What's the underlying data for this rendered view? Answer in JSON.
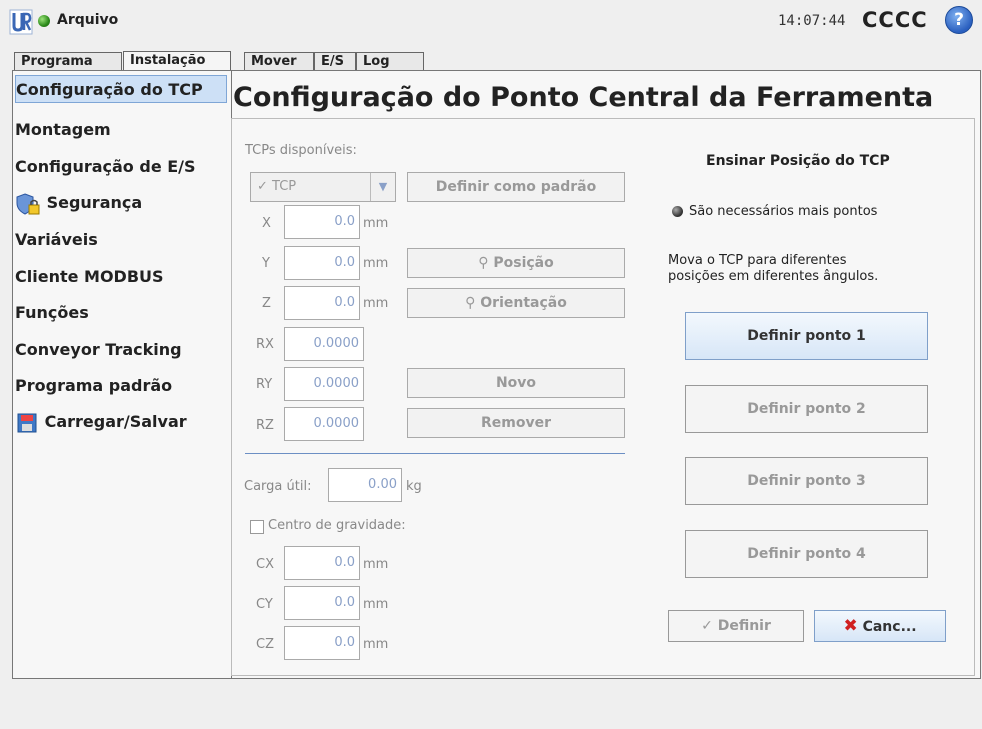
{
  "header": {
    "app_title": "Arquivo",
    "clock": "14:07:44",
    "robot_name": "CCCC",
    "help_label": "?"
  },
  "tabs": [
    {
      "label": "Programa"
    },
    {
      "label": "Instalação"
    },
    {
      "label": "Mover"
    },
    {
      "label": "E/S"
    },
    {
      "label": "Log"
    }
  ],
  "sidebar": {
    "items": [
      {
        "label": "Configuração do TCP"
      },
      {
        "label": "Montagem"
      },
      {
        "label": "Configuração de E/S"
      },
      {
        "label": "Segurança"
      },
      {
        "label": "Variáveis"
      },
      {
        "label": "Cliente MODBUS"
      },
      {
        "label": "Funções"
      },
      {
        "label": "Conveyor Tracking"
      },
      {
        "label": "Programa padrão"
      },
      {
        "label": "Carregar/Salvar"
      }
    ]
  },
  "page": {
    "title": "Configuração do Ponto Central da Ferramenta"
  },
  "tcp": {
    "available_label": "TCPs disponíveis:",
    "selected": "TCP",
    "set_default": "Definir como padrão",
    "unit_mm": "mm",
    "unit_kg": "kg",
    "x_label": "X",
    "x_value": "0.0",
    "y_label": "Y",
    "y_value": "0.0",
    "z_label": "Z",
    "z_value": "0.0",
    "rx_label": "RX",
    "rx_value": "0.0000",
    "ry_label": "RY",
    "ry_value": "0.0000",
    "rz_label": "RZ",
    "rz_value": "0.0000",
    "position_btn": "Posição",
    "orientation_btn": "Orientação",
    "new_btn": "Novo",
    "remove_btn": "Remover",
    "payload_label": "Carga útil:",
    "payload_value": "0.00",
    "cog_label": "Centro de gravidade:",
    "cx_label": "CX",
    "cx_value": "0.0",
    "cy_label": "CY",
    "cy_value": "0.0",
    "cz_label": "CZ",
    "cz_value": "0.0"
  },
  "teach": {
    "title": "Ensinar Posição do TCP",
    "status": "São necessários mais pontos",
    "instruction_line1": "Mova o TCP para diferentes",
    "instruction_line2": "posições em diferentes ângulos.",
    "point1": "Definir ponto 1",
    "point2": "Definir ponto 2",
    "point3": "Definir ponto 3",
    "point4": "Definir ponto 4",
    "set_btn": "Definir",
    "cancel_btn": "Canc..."
  },
  "colors": {
    "accent_blue": "#cde0f6",
    "status_green": "#2b8a1a",
    "cancel_red": "#d02020"
  }
}
